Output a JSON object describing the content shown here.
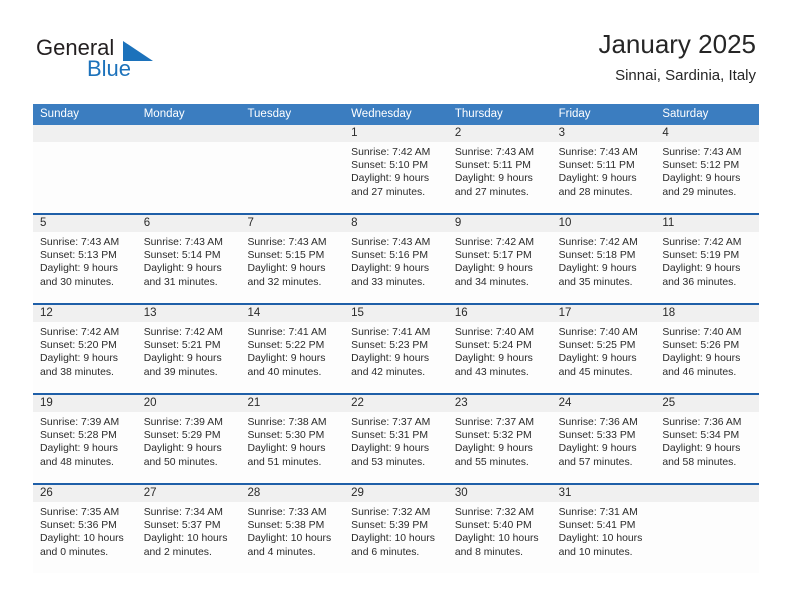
{
  "brand": {
    "word_one": "General",
    "word_two": "Blue",
    "mark_color": "#1c72bb",
    "text_color": "#231f20",
    "icon": "triangle-flag-mark"
  },
  "header": {
    "title": "January 2025",
    "subtitle": "Sinnai, Sardinia, Italy"
  },
  "theme": {
    "header_row_bg": "#3b7dc0",
    "week_divider": "#1f5fa8",
    "daynum_bg": "#f0f0f0",
    "cell_bg": "#fdfdfd",
    "text": "#2b2b2b"
  },
  "calendar": {
    "weekday_headers": [
      "Sunday",
      "Monday",
      "Tuesday",
      "Wednesday",
      "Thursday",
      "Friday",
      "Saturday"
    ],
    "labels": {
      "sunrise": "Sunrise:",
      "sunset": "Sunset:",
      "daylight": "Daylight:"
    },
    "weeks": [
      [
        {
          "day": "",
          "lines": []
        },
        {
          "day": "",
          "lines": []
        },
        {
          "day": "",
          "lines": []
        },
        {
          "day": "1",
          "lines": [
            "Sunrise: 7:42 AM",
            "Sunset: 5:10 PM",
            "Daylight: 9 hours",
            "and 27 minutes."
          ]
        },
        {
          "day": "2",
          "lines": [
            "Sunrise: 7:43 AM",
            "Sunset: 5:11 PM",
            "Daylight: 9 hours",
            "and 27 minutes."
          ]
        },
        {
          "day": "3",
          "lines": [
            "Sunrise: 7:43 AM",
            "Sunset: 5:11 PM",
            "Daylight: 9 hours",
            "and 28 minutes."
          ]
        },
        {
          "day": "4",
          "lines": [
            "Sunrise: 7:43 AM",
            "Sunset: 5:12 PM",
            "Daylight: 9 hours",
            "and 29 minutes."
          ]
        }
      ],
      [
        {
          "day": "5",
          "lines": [
            "Sunrise: 7:43 AM",
            "Sunset: 5:13 PM",
            "Daylight: 9 hours",
            "and 30 minutes."
          ]
        },
        {
          "day": "6",
          "lines": [
            "Sunrise: 7:43 AM",
            "Sunset: 5:14 PM",
            "Daylight: 9 hours",
            "and 31 minutes."
          ]
        },
        {
          "day": "7",
          "lines": [
            "Sunrise: 7:43 AM",
            "Sunset: 5:15 PM",
            "Daylight: 9 hours",
            "and 32 minutes."
          ]
        },
        {
          "day": "8",
          "lines": [
            "Sunrise: 7:43 AM",
            "Sunset: 5:16 PM",
            "Daylight: 9 hours",
            "and 33 minutes."
          ]
        },
        {
          "day": "9",
          "lines": [
            "Sunrise: 7:42 AM",
            "Sunset: 5:17 PM",
            "Daylight: 9 hours",
            "and 34 minutes."
          ]
        },
        {
          "day": "10",
          "lines": [
            "Sunrise: 7:42 AM",
            "Sunset: 5:18 PM",
            "Daylight: 9 hours",
            "and 35 minutes."
          ]
        },
        {
          "day": "11",
          "lines": [
            "Sunrise: 7:42 AM",
            "Sunset: 5:19 PM",
            "Daylight: 9 hours",
            "and 36 minutes."
          ]
        }
      ],
      [
        {
          "day": "12",
          "lines": [
            "Sunrise: 7:42 AM",
            "Sunset: 5:20 PM",
            "Daylight: 9 hours",
            "and 38 minutes."
          ]
        },
        {
          "day": "13",
          "lines": [
            "Sunrise: 7:42 AM",
            "Sunset: 5:21 PM",
            "Daylight: 9 hours",
            "and 39 minutes."
          ]
        },
        {
          "day": "14",
          "lines": [
            "Sunrise: 7:41 AM",
            "Sunset: 5:22 PM",
            "Daylight: 9 hours",
            "and 40 minutes."
          ]
        },
        {
          "day": "15",
          "lines": [
            "Sunrise: 7:41 AM",
            "Sunset: 5:23 PM",
            "Daylight: 9 hours",
            "and 42 minutes."
          ]
        },
        {
          "day": "16",
          "lines": [
            "Sunrise: 7:40 AM",
            "Sunset: 5:24 PM",
            "Daylight: 9 hours",
            "and 43 minutes."
          ]
        },
        {
          "day": "17",
          "lines": [
            "Sunrise: 7:40 AM",
            "Sunset: 5:25 PM",
            "Daylight: 9 hours",
            "and 45 minutes."
          ]
        },
        {
          "day": "18",
          "lines": [
            "Sunrise: 7:40 AM",
            "Sunset: 5:26 PM",
            "Daylight: 9 hours",
            "and 46 minutes."
          ]
        }
      ],
      [
        {
          "day": "19",
          "lines": [
            "Sunrise: 7:39 AM",
            "Sunset: 5:28 PM",
            "Daylight: 9 hours",
            "and 48 minutes."
          ]
        },
        {
          "day": "20",
          "lines": [
            "Sunrise: 7:39 AM",
            "Sunset: 5:29 PM",
            "Daylight: 9 hours",
            "and 50 minutes."
          ]
        },
        {
          "day": "21",
          "lines": [
            "Sunrise: 7:38 AM",
            "Sunset: 5:30 PM",
            "Daylight: 9 hours",
            "and 51 minutes."
          ]
        },
        {
          "day": "22",
          "lines": [
            "Sunrise: 7:37 AM",
            "Sunset: 5:31 PM",
            "Daylight: 9 hours",
            "and 53 minutes."
          ]
        },
        {
          "day": "23",
          "lines": [
            "Sunrise: 7:37 AM",
            "Sunset: 5:32 PM",
            "Daylight: 9 hours",
            "and 55 minutes."
          ]
        },
        {
          "day": "24",
          "lines": [
            "Sunrise: 7:36 AM",
            "Sunset: 5:33 PM",
            "Daylight: 9 hours",
            "and 57 minutes."
          ]
        },
        {
          "day": "25",
          "lines": [
            "Sunrise: 7:36 AM",
            "Sunset: 5:34 PM",
            "Daylight: 9 hours",
            "and 58 minutes."
          ]
        }
      ],
      [
        {
          "day": "26",
          "lines": [
            "Sunrise: 7:35 AM",
            "Sunset: 5:36 PM",
            "Daylight: 10 hours",
            "and 0 minutes."
          ]
        },
        {
          "day": "27",
          "lines": [
            "Sunrise: 7:34 AM",
            "Sunset: 5:37 PM",
            "Daylight: 10 hours",
            "and 2 minutes."
          ]
        },
        {
          "day": "28",
          "lines": [
            "Sunrise: 7:33 AM",
            "Sunset: 5:38 PM",
            "Daylight: 10 hours",
            "and 4 minutes."
          ]
        },
        {
          "day": "29",
          "lines": [
            "Sunrise: 7:32 AM",
            "Sunset: 5:39 PM",
            "Daylight: 10 hours",
            "and 6 minutes."
          ]
        },
        {
          "day": "30",
          "lines": [
            "Sunrise: 7:32 AM",
            "Sunset: 5:40 PM",
            "Daylight: 10 hours",
            "and 8 minutes."
          ]
        },
        {
          "day": "31",
          "lines": [
            "Sunrise: 7:31 AM",
            "Sunset: 5:41 PM",
            "Daylight: 10 hours",
            "and 10 minutes."
          ]
        },
        {
          "day": "",
          "lines": []
        }
      ]
    ]
  }
}
